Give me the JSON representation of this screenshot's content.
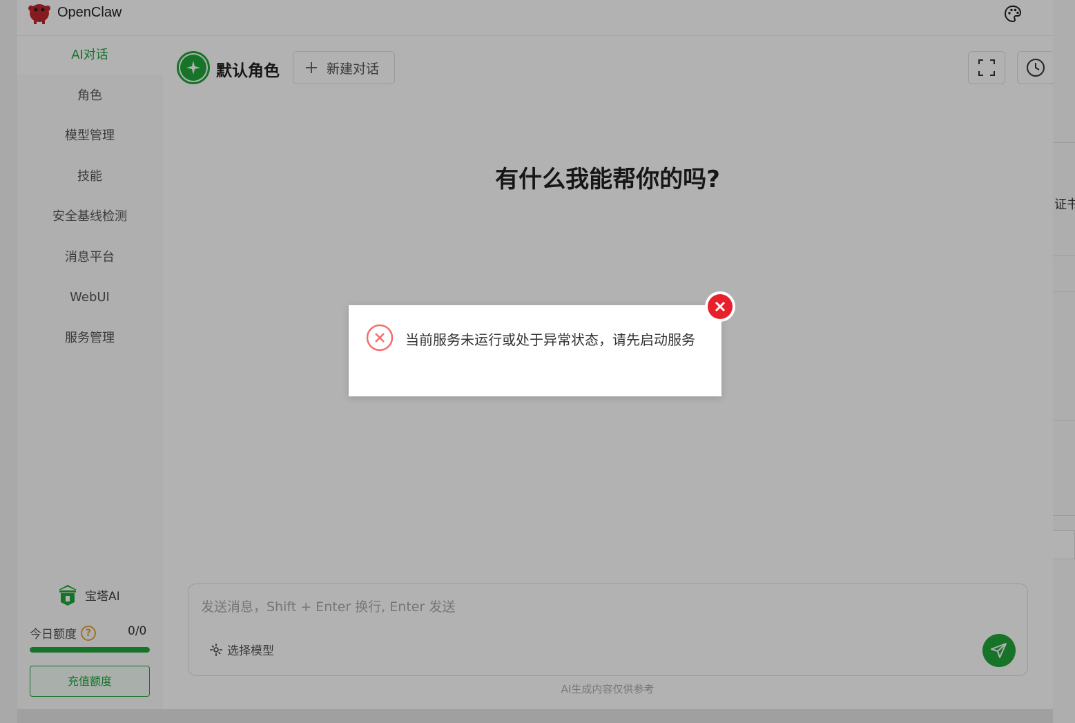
{
  "app": {
    "name": "OpenClaw",
    "accent_color": "#20a53a"
  },
  "background": {
    "partial_text": "证书"
  },
  "sidebar": {
    "items": [
      {
        "label": "AI对话",
        "active": true
      },
      {
        "label": "角色",
        "active": false
      },
      {
        "label": "模型管理",
        "active": false
      },
      {
        "label": "技能",
        "active": false
      },
      {
        "label": "安全基线检测",
        "active": false
      },
      {
        "label": "消息平台",
        "active": false
      },
      {
        "label": "WebUI",
        "active": false
      },
      {
        "label": "服务管理",
        "active": false
      }
    ],
    "brand_label": "宝塔AI",
    "quota_label": "今日额度",
    "quota_value": "0/0",
    "quota_fill_fraction": 1.0,
    "recharge_label": "充值额度"
  },
  "header": {
    "role_name": "默认角色",
    "new_chat_label": "新建对话",
    "icons": [
      "fullscreen-icon",
      "history-icon"
    ]
  },
  "chat": {
    "welcome": "有什么我能帮你的吗?",
    "input_placeholder": "发送消息，Shift + Enter 换行, Enter 发送",
    "model_select_label": "选择模型",
    "disclaimer": "AI生成内容仅供参考"
  },
  "dialog": {
    "message": "当前服务未运行或处于异常状态，请先启动服务",
    "error_color": "#e8202b"
  }
}
